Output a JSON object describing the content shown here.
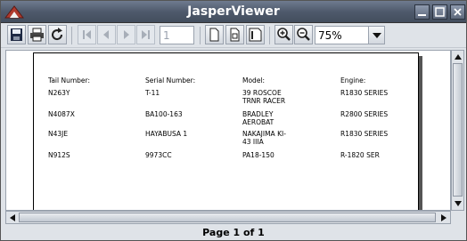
{
  "window": {
    "title": "JasperViewer"
  },
  "toolbar": {
    "page_number": "1",
    "zoom": "75%"
  },
  "report": {
    "headers": [
      "Tail Number:",
      "Serial Number:",
      "Model:",
      "Engine:"
    ],
    "rows": [
      [
        "N263Y",
        "T-11",
        "39 ROSCOE\nTRNR RACER",
        "R1830 SERIES"
      ],
      [
        "N4087X",
        "BA100-163",
        "BRADLEY\nAEROBAT",
        "R2800 SERIES"
      ],
      [
        "N43JE",
        "HAYABUSA 1",
        "NAKAJIMA KI-\n43 IIIA",
        "R1830 SERIES"
      ],
      [
        "N912S",
        "9973CC",
        "PA18-150",
        "R-1820 SER"
      ]
    ]
  },
  "status": {
    "page_label": "Page 1 of 1"
  },
  "colors": {
    "titlebar": "#4f5a6c",
    "window_bg": "#dfe3e8",
    "icon_red": "#c0392b"
  }
}
